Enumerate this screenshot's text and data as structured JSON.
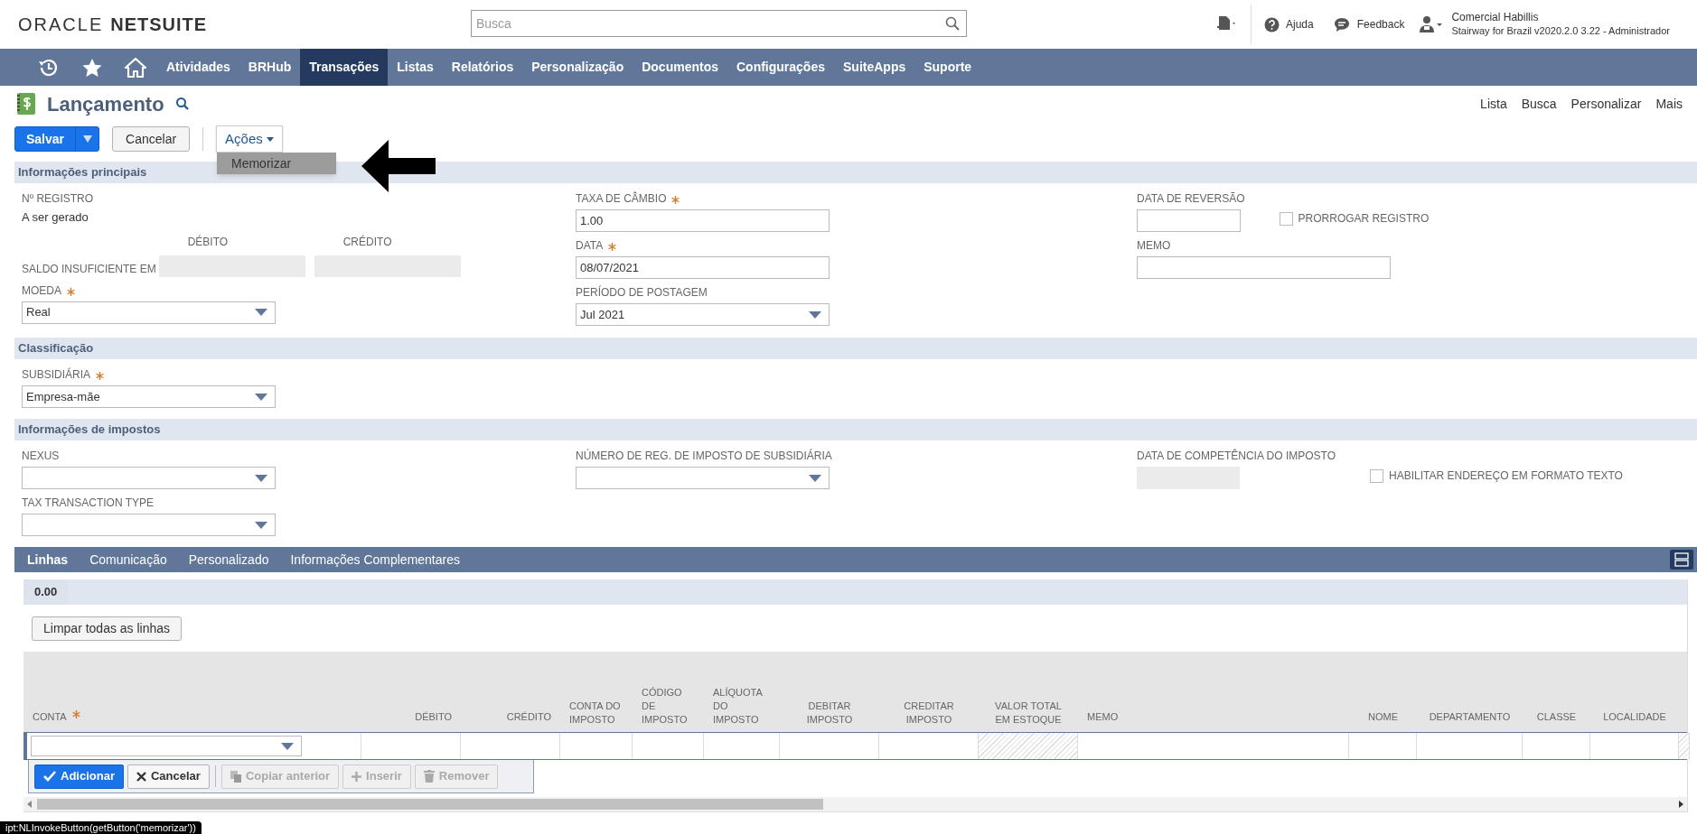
{
  "header": {
    "logo": {
      "part1": "ORACLE",
      "part2": "NETSUITE"
    },
    "search": {
      "placeholder": "Busca"
    },
    "help": "Ajuda",
    "feedback": "Feedback",
    "user": {
      "name": "Comercial Habillis",
      "role": "Stairway for Brazil v2020.2.0 3.22 - Administrador"
    }
  },
  "nav": {
    "items": [
      {
        "label": "Atividades",
        "selected": false
      },
      {
        "label": "BRHub",
        "selected": false
      },
      {
        "label": "Transações",
        "selected": true
      },
      {
        "label": "Listas",
        "selected": false
      },
      {
        "label": "Relatórios",
        "selected": false
      },
      {
        "label": "Personalização",
        "selected": false
      },
      {
        "label": "Documentos",
        "selected": false
      },
      {
        "label": "Configurações",
        "selected": false
      },
      {
        "label": "SuiteApps",
        "selected": false
      },
      {
        "label": "Suporte",
        "selected": false
      }
    ]
  },
  "page": {
    "title": "Lançamento",
    "links": [
      "Lista",
      "Busca",
      "Personalizar",
      "Mais"
    ]
  },
  "toolbar": {
    "save": "Salvar",
    "cancel": "Cancelar",
    "actions": {
      "label": "Ações",
      "expanded": true,
      "items": [
        {
          "label": "Memorizar",
          "selected": true
        }
      ]
    }
  },
  "sections": [
    {
      "title": "Informações principais",
      "columns": [
        [
          {
            "kind": "display",
            "label": "Nº REGISTRO",
            "value": "A ser gerado"
          },
          {
            "kind": "balance",
            "label": "SALDO INSUFICIENTE EM",
            "headings": [
              "DÉBITO",
              "CRÉDITO"
            ]
          },
          {
            "kind": "select",
            "label": "MOEDA",
            "required": true,
            "value": "Real"
          }
        ],
        [
          {
            "kind": "input",
            "label": "TAXA DE CÂMBIO",
            "required": true,
            "value": "1.00"
          },
          {
            "kind": "input",
            "label": "DATA",
            "required": true,
            "value": "08/07/2021"
          },
          {
            "kind": "select",
            "label": "PERÍODO DE POSTAGEM",
            "value": "Jul 2021"
          }
        ],
        [
          {
            "kind": "short_input",
            "label": "DATA DE REVERSÃO",
            "checkbox": {
              "label": "PRORROGAR REGISTRO",
              "checked": false
            }
          },
          {
            "kind": "input",
            "label": "MEMO"
          }
        ]
      ]
    },
    {
      "title": "Classificação",
      "columns": [
        [
          {
            "kind": "select",
            "label": "SUBSIDIÁRIA",
            "required": true,
            "value": "Empresa-mãe"
          }
        ],
        [],
        []
      ]
    },
    {
      "title": "Informações de impostos",
      "columns": [
        [
          {
            "kind": "select",
            "label": "NEXUS"
          },
          {
            "kind": "select",
            "label": "TAX TRANSACTION TYPE"
          }
        ],
        [
          {
            "kind": "select",
            "label": "NÚMERO DE REG. DE IMPOSTO DE SUBSIDIÁRIA"
          }
        ],
        [
          {
            "kind": "disabled_input",
            "label": "DATA DE COMPETÊNCIA DO IMPOSTO",
            "checkbox": {
              "label": "HABILITAR ENDEREÇO EM FORMATO TEXTO",
              "checked": false
            }
          }
        ]
      ]
    }
  ],
  "sublist": {
    "tabs": [
      {
        "label": "Linhas",
        "selected": true
      },
      {
        "label": "Comunicação",
        "selected": false
      },
      {
        "label": "Personalizado",
        "selected": false
      },
      {
        "label": "Informações Complementares",
        "selected": false
      }
    ],
    "total": "0.00",
    "clear_button": "Limpar todas as linhas",
    "columns": [
      {
        "label": "CONTA",
        "required": true,
        "kind": "select"
      },
      {
        "label": "DÉBITO",
        "kind": "text"
      },
      {
        "label": "CRÉDITO",
        "kind": "text"
      },
      {
        "label": "CONTA DO IMPOSTO",
        "kind": "text"
      },
      {
        "label": "CÓDIGO DE IMPOSTO",
        "kind": "text"
      },
      {
        "label": "ALÍQUOTA DO IMPOSTO",
        "kind": "text"
      },
      {
        "label": "DEBITAR IMPOSTO",
        "kind": "text"
      },
      {
        "label": "CREDITAR IMPOSTO",
        "kind": "text"
      },
      {
        "label": "VALOR TOTAL EM ESTOQUE",
        "kind": "hatched"
      },
      {
        "label": "MEMO",
        "kind": "text"
      },
      {
        "label": "NOME",
        "kind": "text"
      },
      {
        "label": "DEPARTAMENTO",
        "kind": "text"
      },
      {
        "label": "CLASSE",
        "kind": "text"
      },
      {
        "label": "LOCALIDADE",
        "kind": "text"
      },
      {
        "kind": "hatched"
      }
    ],
    "row_buttons": [
      {
        "label": "Adicionar",
        "kind": "primary",
        "disabled": false
      },
      {
        "label": "Cancelar",
        "kind": "cancel",
        "disabled": false
      },
      {
        "label": "Copiar anterior",
        "kind": "copy",
        "disabled": true
      },
      {
        "label": "Inserir",
        "kind": "insert",
        "disabled": true
      },
      {
        "label": "Remover",
        "kind": "remove",
        "disabled": true
      }
    ]
  },
  "status_bar": "ipt:NLInvokeButton(getButton('memorizar'))"
}
